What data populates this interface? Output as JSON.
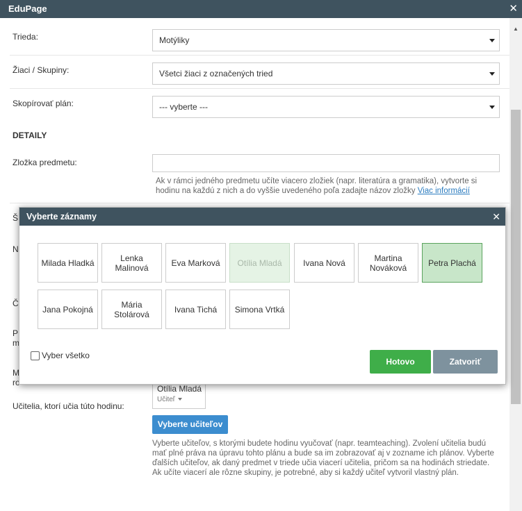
{
  "window": {
    "title": "EduPage"
  },
  "form": {
    "trieda": {
      "label": "Trieda:",
      "value": "Motýliky"
    },
    "ziaci": {
      "label": "Žiaci / Skupiny:",
      "value": "Všetci žiaci z označených tried"
    },
    "kopirovat": {
      "label": "Skopírovať plán:",
      "value": "--- vyberte ---"
    },
    "section_title": "DETAILY",
    "zlozka": {
      "label": "Zložka predmetu:",
      "help": "Ak v rámci jedného predmetu učíte viacero zložiek (napr. literatúra a gramatika), vytvorte si hodinu na každú z nich a do vyššie uvedeného poľa zadajte názov zložky",
      "link": "Viac informácií"
    },
    "fragments": [
      "Š",
      "N",
      "Č",
      "P",
      "m",
      "M",
      "ro"
    ],
    "ucitelia": {
      "label": "Učitelia, ktorí učia túto hodinu:",
      "teacher_name": "Otília Mladá",
      "teacher_role": "Učiteľ",
      "button": "Vyberte učiteľov",
      "help": "Vyberte učiteľov, s ktorými budete hodinu vyučovať (napr. teamteaching). Zvolení učitelia budú mať plné práva na úpravu tohto plánu a bude sa im zobrazovať aj v zozname ich plánov. Vyberte ďalších učiteľov, ak daný predmet v triede učia viacerí učitelia, pričom sa na hodinách striedate. Ak učíte viacerí ale rôzne skupiny, je potrebné, aby si každý učiteľ vytvoril vlastný plán."
    }
  },
  "modal": {
    "title": "Vyberte záznamy",
    "items": [
      {
        "name": "Milada Hladká",
        "state": "normal"
      },
      {
        "name": "Lenka Malinová",
        "state": "normal"
      },
      {
        "name": "Eva Marková",
        "state": "normal"
      },
      {
        "name": "Otília Mladá",
        "state": "disabled"
      },
      {
        "name": "Ivana Nová",
        "state": "normal"
      },
      {
        "name": "Martina Nováková",
        "state": "normal"
      },
      {
        "name": "Petra Plachá",
        "state": "selected"
      },
      {
        "name": "Jana Pokojná",
        "state": "normal"
      },
      {
        "name": "Mária Stolárová",
        "state": "normal"
      },
      {
        "name": "Ivana Tichá",
        "state": "normal"
      },
      {
        "name": "Simona Vrtká",
        "state": "normal"
      }
    ],
    "select_all": "Vyber všetko",
    "done": "Hotovo",
    "close": "Zatvoriť"
  },
  "colors": {
    "header": "#3f535f",
    "accent_blue": "#3c8dcf",
    "done_green": "#3fae49",
    "close_gray": "#7e929e",
    "selected_green": "#c8e6c9"
  }
}
